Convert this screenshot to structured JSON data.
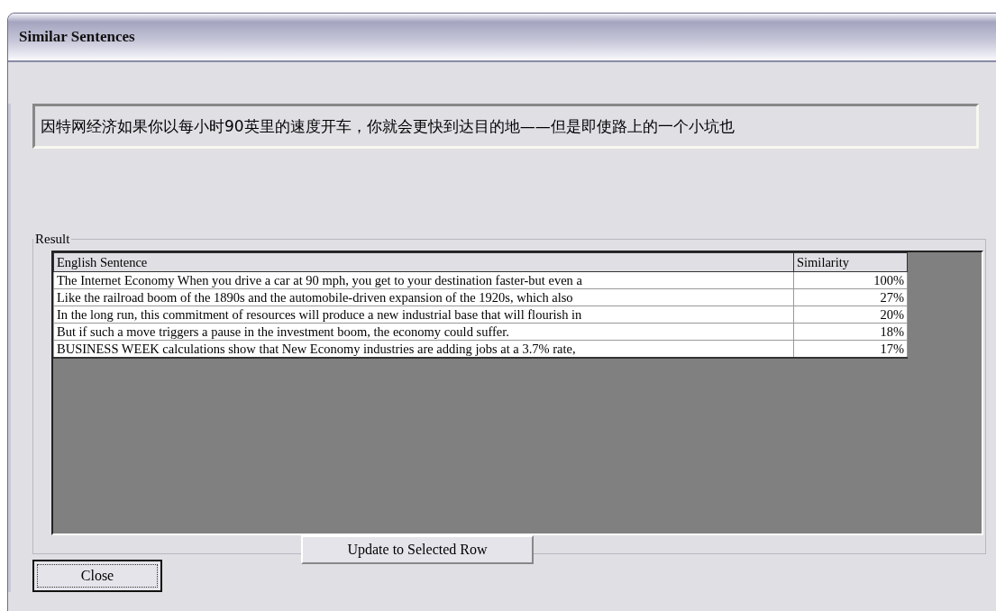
{
  "window": {
    "title": "Similar Sentences"
  },
  "source_field": {
    "value": "因特网经济如果你以每小时90英里的速度开车，你就会更快到达目的地——但是即使路上的一个小坑也"
  },
  "result_group": {
    "label": "Result",
    "table": {
      "columns": [
        "English Sentence",
        "Similarity"
      ],
      "rows": [
        {
          "sentence": "The Internet Economy When you drive a car at 90 mph, you get to your destination faster-but even a",
          "similarity": "100%"
        },
        {
          "sentence": "Like the railroad boom of the 1890s and the automobile-driven expansion of the 1920s, which also",
          "similarity": "27%"
        },
        {
          "sentence": "In the long run, this commitment of resources will produce a new industrial base that will flourish in",
          "similarity": "20%"
        },
        {
          "sentence": "But if such a move triggers a pause in the investment boom, the economy could suffer.",
          "similarity": "18%"
        },
        {
          "sentence": "BUSINESS WEEK calculations show that New Economy industries are adding jobs at a 3.7% rate,",
          "similarity": "17%"
        }
      ]
    },
    "update_button": "Update to Selected Row"
  },
  "close_button": {
    "label": "Close",
    "focused": true
  }
}
